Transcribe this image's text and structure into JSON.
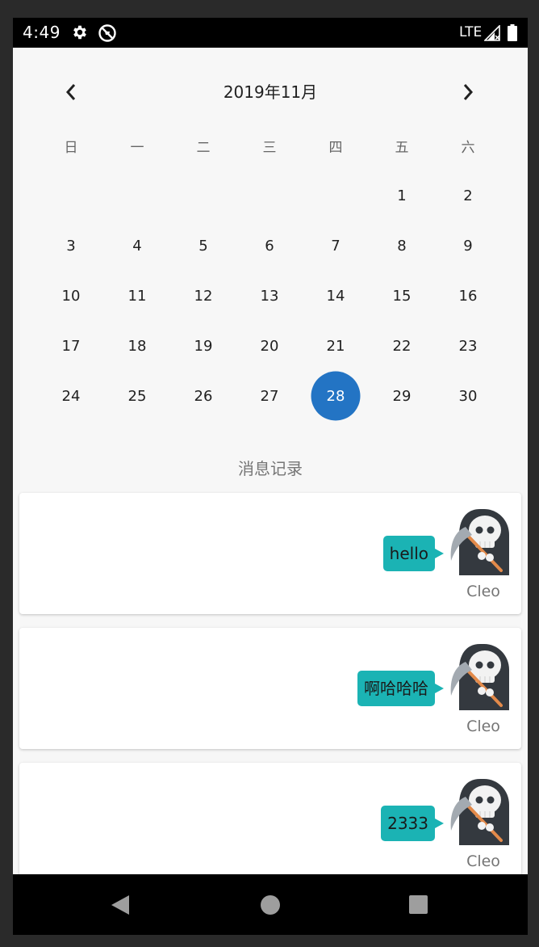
{
  "status_bar": {
    "time": "4:49",
    "network": "LTE",
    "icons": [
      "gear-icon",
      "dnd-icon",
      "signal-icon",
      "battery-icon"
    ]
  },
  "calendar": {
    "title": "2019年11月",
    "weekdays": [
      "日",
      "一",
      "二",
      "三",
      "四",
      "五",
      "六"
    ],
    "leading_blanks": 5,
    "days": [
      "1",
      "2",
      "3",
      "4",
      "5",
      "6",
      "7",
      "8",
      "9",
      "10",
      "11",
      "12",
      "13",
      "14",
      "15",
      "16",
      "17",
      "18",
      "19",
      "20",
      "21",
      "22",
      "23",
      "24",
      "25",
      "26",
      "27",
      "28",
      "29",
      "30"
    ],
    "selected_day": "28",
    "selected_color": "#2374c4"
  },
  "messages_section": {
    "title": "消息记录",
    "messages": [
      {
        "text": "hello",
        "sender": "Cleo"
      },
      {
        "text": "啊哈哈哈",
        "sender": "Cleo"
      },
      {
        "text": "2333",
        "sender": "Cleo"
      }
    ],
    "bubble_color": "#1bb3b4"
  },
  "nav_bar": {
    "icons": [
      "back-icon",
      "home-icon",
      "recents-icon"
    ]
  }
}
